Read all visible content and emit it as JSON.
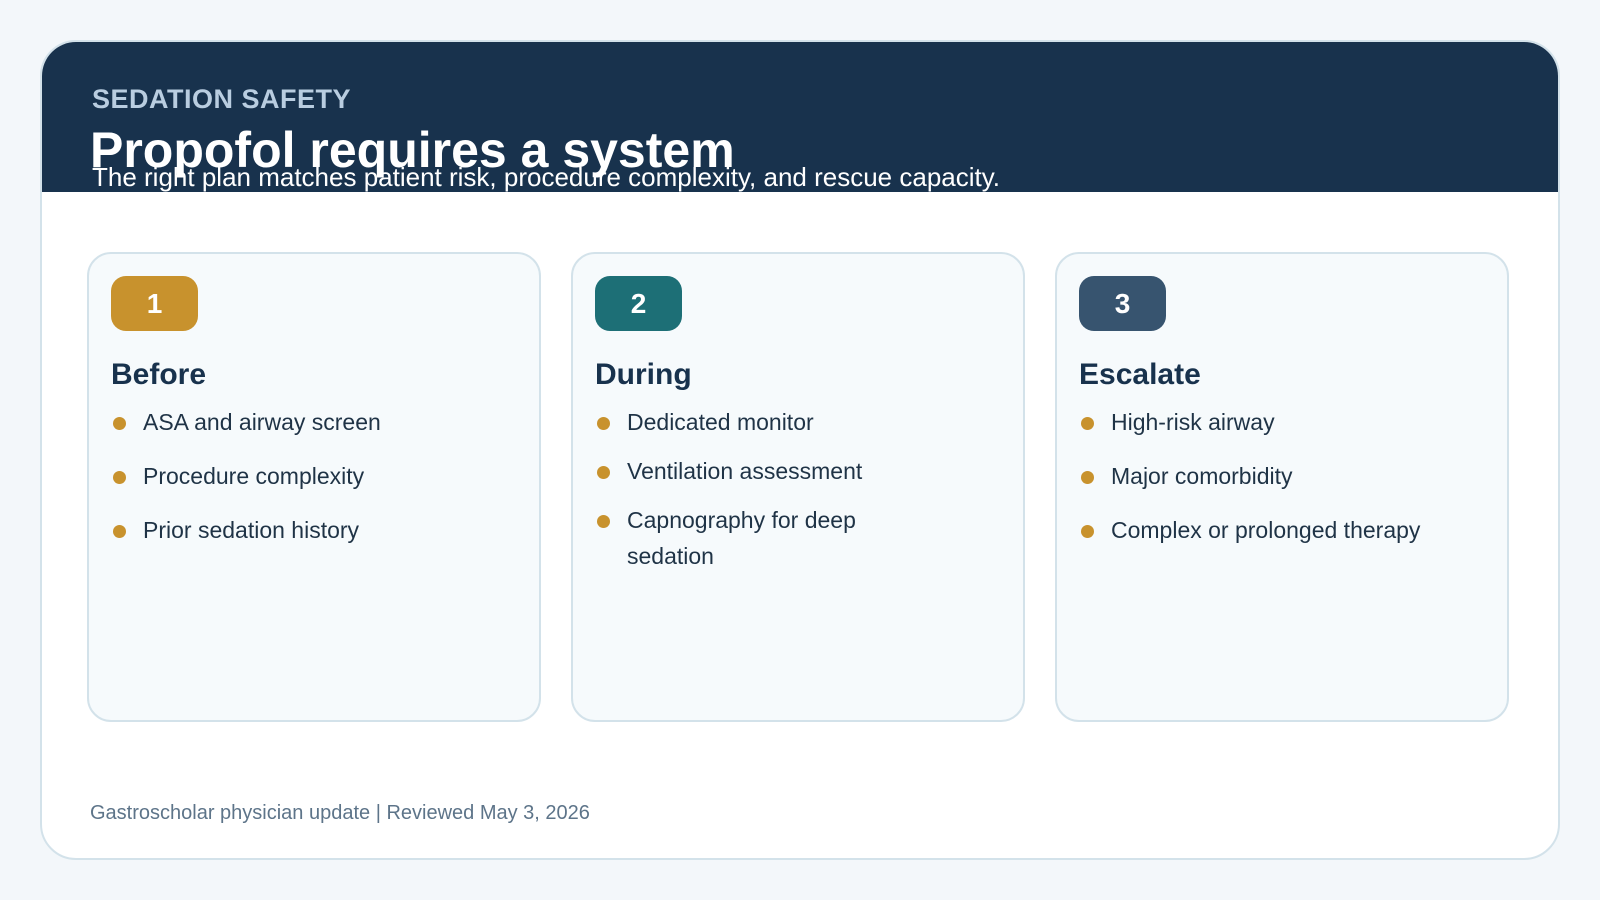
{
  "header": {
    "eyebrow": "SEDATION SAFETY",
    "title": "Propofol requires a system",
    "subtitle": "The right plan matches patient risk, procedure complexity, and rescue capacity."
  },
  "colors": {
    "header_bg": "#18324d",
    "bullet": "#c8922d",
    "badge_1": "#c8922d",
    "badge_2": "#1d6f76",
    "badge_3": "#37546f"
  },
  "cards": [
    {
      "number": "1",
      "title": "Before",
      "items": [
        "ASA and airway screen",
        "Procedure complexity",
        "Prior sedation history"
      ]
    },
    {
      "number": "2",
      "title": "During",
      "items": [
        "Dedicated monitor",
        "Ventilation assessment",
        "Capnography for deep sedation"
      ]
    },
    {
      "number": "3",
      "title": "Escalate",
      "items": [
        "High-risk airway",
        "Major comorbidity",
        "Complex or prolonged therapy"
      ]
    }
  ],
  "footer": {
    "text": "Gastroscholar physician update | Reviewed May 3, 2026"
  }
}
